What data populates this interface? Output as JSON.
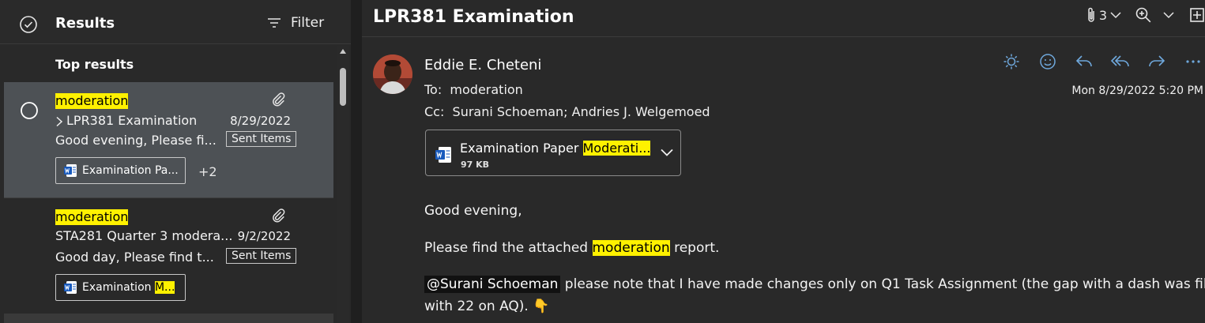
{
  "left_pane": {
    "title": "Results",
    "filter_label": "Filter",
    "section_label": "Top results",
    "items": [
      {
        "keyword": "moderation",
        "subject": "LPR381 Examination",
        "date": "8/29/2022",
        "preview": "Good evening, Please fi...",
        "folder": "Sent Items",
        "attachment_label": "Examination Pa...",
        "extra_count": "+2",
        "selected": true
      },
      {
        "keyword": "moderation",
        "subject": "STA281 Quarter 3 modera...",
        "date": "9/2/2022",
        "preview": "Good day, Please find t...",
        "folder": "Sent Items",
        "attachment_label_plain": "Examination ",
        "attachment_label_hl": "M..."
      }
    ]
  },
  "reading_pane": {
    "subject": "LPR381 Examination",
    "attachment_count": "3",
    "sender": "Eddie E. Cheteni",
    "to_label": "To:",
    "to": "moderation",
    "cc_label": "Cc:",
    "cc": "Surani Schoeman;  Andries J. Welgemoed",
    "date": "Mon 8/29/2022 5:20 PM",
    "attachment": {
      "name_plain": "Examination Paper ",
      "name_hl": "Moderati...",
      "size": "97 KB"
    },
    "body": {
      "greeting": "Good evening,",
      "line1_a": "Please find the attached ",
      "line1_hl": "moderation",
      "line1_b": " report.",
      "mention": "@Surani Schoeman",
      "line2": " please note that I have made changes only on Q1 Task Assignment (the gap with a dash was filled",
      "line3": "with 22 on AQ). 👇"
    }
  },
  "colors": {
    "highlight": "#fff100",
    "selected_row": "#4d5155",
    "background": "#292929",
    "word_blue": "#185abd"
  }
}
